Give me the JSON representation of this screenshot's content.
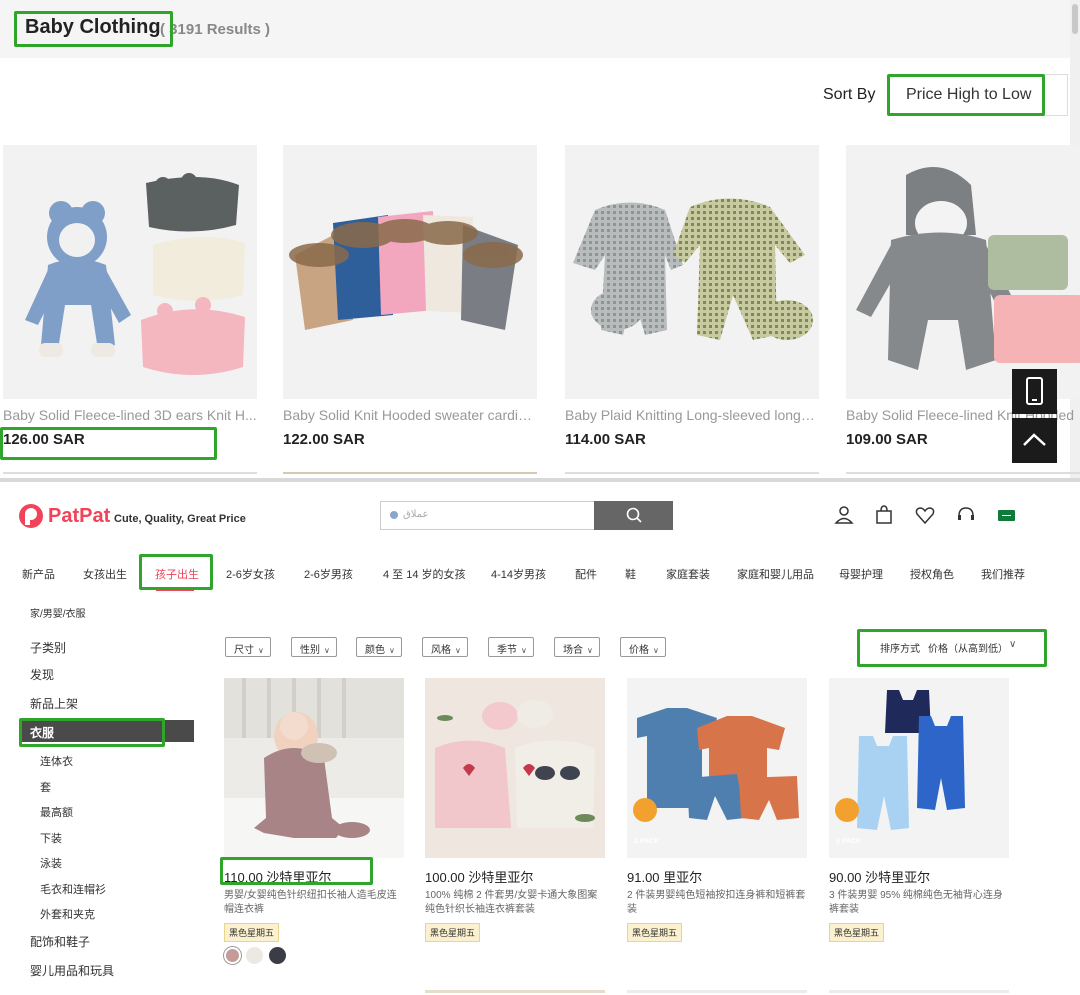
{
  "top_panel": {
    "title": "Baby Clothing",
    "results": "( 3191 Results )",
    "sort_label": "Sort By",
    "sort_value": "Price High to Low",
    "products": [
      {
        "name": "Baby Solid Fleece-lined 3D ears Knit H...",
        "price": "126.00 SAR"
      },
      {
        "name": "Baby Solid Knit Hooded sweater cardigan",
        "price": "122.00 SAR"
      },
      {
        "name": "Baby Plaid Knitting Long-sleeved long-l...",
        "price": "114.00 SAR"
      },
      {
        "name": "Baby Solid Fleece-lined Knit Hooded",
        "price": "109.00 SAR"
      }
    ],
    "floating_buttons": [
      "phone-icon",
      "arrow-up-icon"
    ]
  },
  "bottom_panel": {
    "brand": "PatPat",
    "tagline": "Cute, Quality, Great Price",
    "search_placeholder": "عملاق",
    "header_icons": [
      "user-icon",
      "bag-icon",
      "heart-icon",
      "support-icon",
      "flag-icon"
    ],
    "nav": [
      "新产品",
      "女孩出生",
      "孩子出生",
      "2-6岁女孩",
      "2-6岁男孩",
      "4 至 14 岁的女孩",
      "4-14岁男孩",
      "配件",
      "鞋",
      "家庭套装",
      "家庭和婴儿用品",
      "母婴护理",
      "授权角色",
      "我们推荐"
    ],
    "active_nav": "孩子出生",
    "breadcrumb": "家/男婴/衣服",
    "sidebar": {
      "top_items": [
        "子类别",
        "发现",
        "新品上架"
      ],
      "active": "衣服",
      "sub_items": [
        "连体衣",
        "套",
        "最高额",
        "下装",
        "泳装",
        "毛衣和连帽衫",
        "外套和夹克"
      ],
      "bottom_items": [
        "配饰和鞋子",
        "婴儿用品和玩具"
      ]
    },
    "filters": [
      "尺寸",
      "性别",
      "颜色",
      "风格",
      "季节",
      "场合",
      "价格"
    ],
    "sort_label": "排序方式",
    "sort_value": "价格（从高到低）",
    "products": [
      {
        "price": "110.00 沙特里亚尔",
        "name": "男婴/女婴纯色针织纽扣长袖人造毛皮连帽连衣裤",
        "badge": "黑色星期五"
      },
      {
        "price": "100.00 沙特里亚尔",
        "name": "100% 纯棉 2 件套男/女婴卡通大象图案纯色针织长袖连衣裤套装",
        "badge": "黑色星期五"
      },
      {
        "price": "91.00 里亚尔",
        "name": "2 件装男婴纯色短袖按扣连身裤和短裤套装",
        "badge": "黑色星期五",
        "pack": "2 PACK"
      },
      {
        "price": "90.00 沙特里亚尔",
        "name": "3 件装男婴 95% 纯棉纯色无袖背心连身裤套装",
        "badge": "黑色星期五",
        "pack": "3 PACK"
      }
    ],
    "colors": {
      "accent": "#f1435a",
      "highlight": "#2fa52a",
      "swatches": [
        "#c79a9a",
        "#ece8e2",
        "#3a3d45"
      ]
    }
  }
}
